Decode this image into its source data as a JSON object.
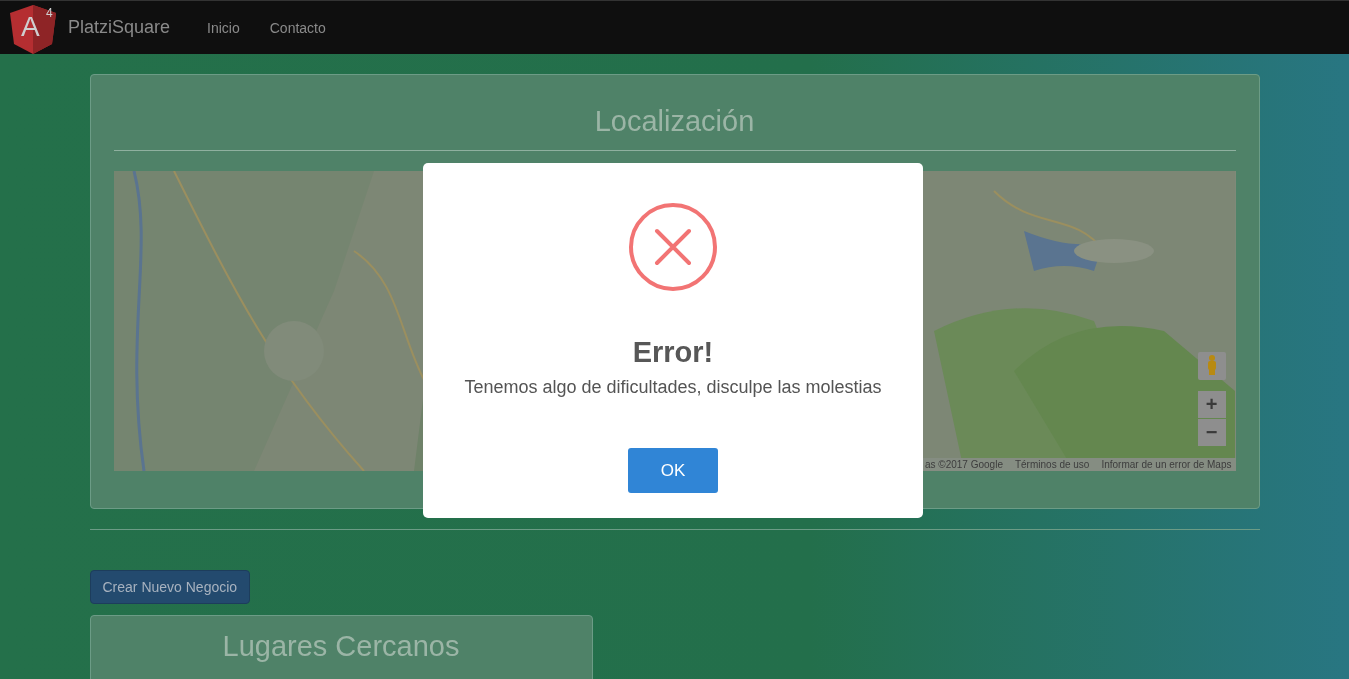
{
  "navbar": {
    "logo_letter": "A",
    "logo_version": "4",
    "brand": "PlatziSquare",
    "links": [
      {
        "label": "Inicio"
      },
      {
        "label": "Contacto"
      }
    ]
  },
  "location_panel": {
    "title": "Localización",
    "map": {
      "kind": "picture",
      "zoom_in": "+",
      "zoom_out": "−",
      "attribution": [
        "as ©2017 Google",
        "Términos de uso",
        "Informar de un error de Maps"
      ]
    }
  },
  "create_button": "Crear Nuevo Negocio",
  "nearby_panel": {
    "title": "Lugares Cercanos"
  },
  "dialog": {
    "kind": "error",
    "title": "Error!",
    "message": "Tenemos algo de dificultades, disculpe las molestias",
    "button": "OK"
  }
}
